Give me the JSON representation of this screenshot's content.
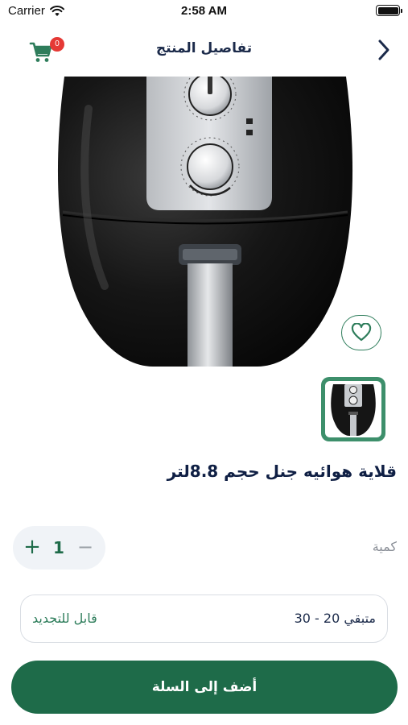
{
  "status_bar": {
    "carrier": "Carrier",
    "time": "2:58 AM"
  },
  "header": {
    "title": "تفاصيل المنتج",
    "cart_count": "0"
  },
  "product": {
    "name": "قلاية هوائيه جنل حجم  8.8لتر",
    "image_icon": "air-fryer-image"
  },
  "quantity": {
    "label": "كمية",
    "value": "1",
    "plus": "+",
    "minus": "−"
  },
  "subscription": {
    "remaining": "متبقي 20 - 30",
    "renewable": "قابل للتجديد"
  },
  "actions": {
    "add_to_cart": "أضف إلى السلة"
  },
  "colors": {
    "primary_green": "#1e6b49",
    "accent_green": "#2e7d5b",
    "badge_red": "#e53935",
    "title_navy": "#0f1f44"
  }
}
